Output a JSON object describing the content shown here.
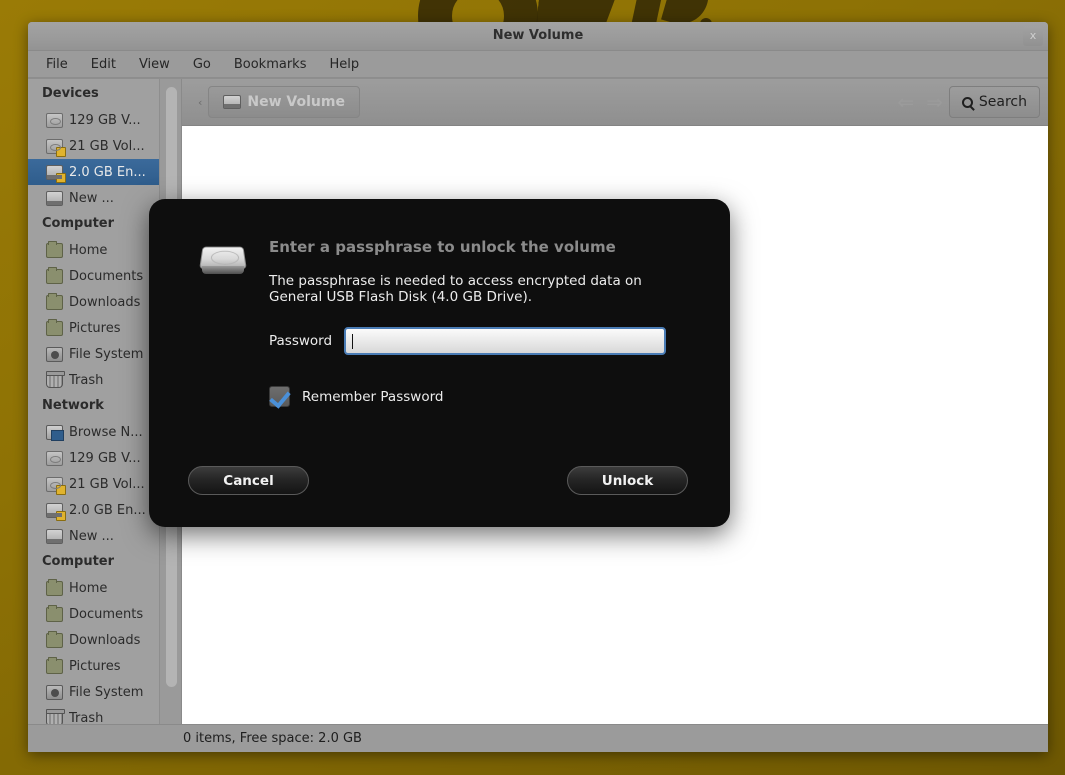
{
  "window": {
    "title": "New Volume",
    "close_label": "x",
    "menus": [
      "File",
      "Edit",
      "View",
      "Go",
      "Bookmarks",
      "Help"
    ]
  },
  "toolbar": {
    "path_prev": "‹",
    "breadcrumb": "New Volume",
    "breadcrumb_icon": "volume-icon",
    "back_icon": "back-arrow-icon",
    "forward_icon": "forward-arrow-icon",
    "search_label": "Search",
    "search_icon": "search-icon"
  },
  "sidebar": {
    "groups": [
      {
        "heading": "Devices",
        "items": [
          {
            "label": "129 GB V...",
            "icon": "drive-icon",
            "selected": false,
            "eject": false
          },
          {
            "label": "21 GB Vol...",
            "icon": "locked-drive-icon",
            "selected": false,
            "eject": false
          },
          {
            "label": "2.0 GB En...",
            "icon": "locked-volume-icon",
            "selected": true,
            "eject": false
          },
          {
            "label": "New ...",
            "icon": "volume-icon",
            "selected": false,
            "eject": true
          }
        ]
      },
      {
        "heading": "Computer",
        "items": [
          {
            "label": "Home",
            "icon": "home-folder-icon",
            "selected": false,
            "eject": false
          },
          {
            "label": "Documents",
            "icon": "documents-folder-icon",
            "selected": false,
            "eject": false
          },
          {
            "label": "Downloads",
            "icon": "downloads-folder-icon",
            "selected": false,
            "eject": false
          },
          {
            "label": "Pictures",
            "icon": "pictures-folder-icon",
            "selected": false,
            "eject": false
          },
          {
            "label": "File System",
            "icon": "file-system-icon",
            "selected": false,
            "eject": false
          },
          {
            "label": "Trash",
            "icon": "trash-icon",
            "selected": false,
            "eject": false
          }
        ]
      },
      {
        "heading": "Network",
        "items": [
          {
            "label": "Browse N...",
            "icon": "network-icon",
            "selected": false,
            "eject": false
          },
          {
            "label": "129 GB V...",
            "icon": "drive-icon",
            "selected": false,
            "eject": false
          },
          {
            "label": "21 GB Vol...",
            "icon": "locked-drive-icon",
            "selected": false,
            "eject": false
          },
          {
            "label": "2.0 GB En...",
            "icon": "locked-volume-icon",
            "selected": false,
            "eject": false
          },
          {
            "label": "New ...",
            "icon": "volume-icon",
            "selected": false,
            "eject": true
          }
        ]
      },
      {
        "heading": "Computer",
        "items": [
          {
            "label": "Home",
            "icon": "home-folder-icon",
            "selected": false,
            "eject": false
          },
          {
            "label": "Documents",
            "icon": "documents-folder-icon",
            "selected": false,
            "eject": false
          },
          {
            "label": "Downloads",
            "icon": "downloads-folder-icon",
            "selected": false,
            "eject": false
          },
          {
            "label": "Pictures",
            "icon": "pictures-folder-icon",
            "selected": false,
            "eject": false
          },
          {
            "label": "File System",
            "icon": "file-system-icon",
            "selected": false,
            "eject": false
          },
          {
            "label": "Trash",
            "icon": "trash-icon",
            "selected": false,
            "eject": false
          }
        ]
      }
    ]
  },
  "status": {
    "text": "0 items, Free space: 2.0 GB"
  },
  "dialog": {
    "icon": "hard-drive-icon",
    "title": "Enter a passphrase to unlock the volume",
    "message": "The passphrase is needed to access encrypted data on General USB Flash Disk (4.0 GB Drive).",
    "password_label": "Password",
    "password_value": "",
    "password_placeholder": "",
    "remember_label": "Remember Password",
    "remember_checked": true,
    "cancel_label": "Cancel",
    "unlock_label": "Unlock"
  },
  "colors": {
    "desktop": "#8e7205",
    "selection": "#2f5d8c",
    "dialog_bg": "#0e0e0e",
    "input_focus_border": "#4a7cb5",
    "checkmark": "#4a90d9"
  }
}
